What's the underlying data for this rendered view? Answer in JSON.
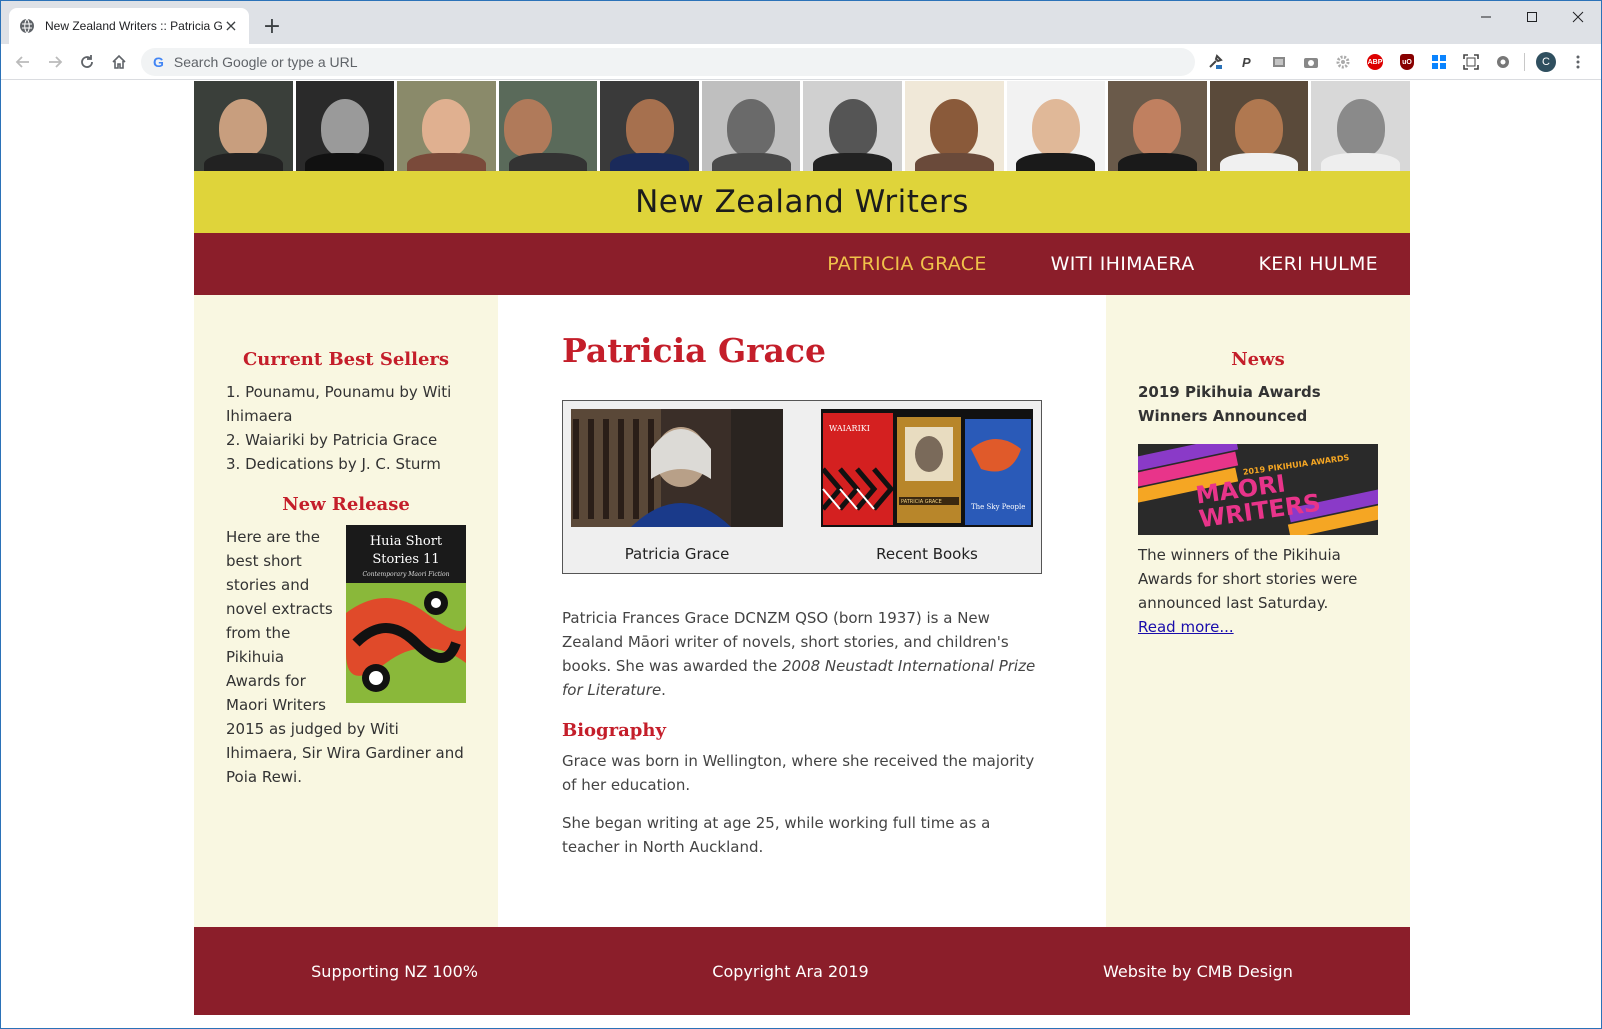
{
  "browser": {
    "tab_title": "New Zealand Writers :: Patricia Gr",
    "tab_close": "×",
    "new_tab": "+",
    "omnibox_placeholder": "Search Google or type a URL",
    "omnibox_logo": "G",
    "profile_initial": "C",
    "ext_abp": "ABP",
    "ext_ubo": "uO"
  },
  "site": {
    "title": "New Zealand Writers",
    "nav": [
      {
        "label": "PATRICIA GRACE",
        "active": true
      },
      {
        "label": "WITI IHIMAERA",
        "active": false
      },
      {
        "label": "KERI HULME",
        "active": false
      }
    ],
    "left": {
      "bestsellers_heading": "Current Best Sellers",
      "bestsellers": [
        "1. Pounamu, Pounamu by Witi Ihimaera",
        "2. Waiariki by Patricia Grace",
        "3. Dedications by J. C. Sturm"
      ],
      "release_heading": "New Release",
      "release_text": "Here are the best short stories and novel extracts from the Pikihuia Awards for Maori Writers 2015 as judged by Witi Ihimaera, Sir Wira Gardiner and Poia Rewi.",
      "release_cover_title": "Huia Short Stories 11",
      "release_cover_sub": "Contemporary Maori Fiction"
    },
    "main": {
      "title": "Patricia Grace",
      "figure1_caption": "Patricia Grace",
      "figure2_caption": "Recent Books",
      "book1_title": "WAIARIKI",
      "book2_title": "PATRICIA GRACE",
      "book3_title": "The Sky People",
      "intro_before": "Patricia Frances Grace DCNZM QSO (born 1937) is a New Zealand Māori writer of novels, short stories, and children's books. She was awarded the ",
      "intro_em": "2008 Neustadt International Prize for Literature",
      "intro_after": ".",
      "bio_heading": "Biography",
      "bio_p1": "Grace was born in Wellington, where she received the majority of her education.",
      "bio_p2": "She began writing at age 25, while working full time as a teacher in North Auckland."
    },
    "right": {
      "news_heading": "News",
      "news_headline": "2019 Pikihuia Awards Winners Announced",
      "news_img_small": "2019 PIKIHUIA AWARDS",
      "news_img_text": "MAORI WRITERS",
      "news_text": "The winners of the Pikihuia Awards for short stories were announced last Saturday.",
      "news_link": "Read more..."
    },
    "footer": {
      "left": "Supporting NZ 100%",
      "center": "Copyright Ara 2019",
      "right": "Website by CMB Design"
    }
  },
  "colors": {
    "banner": "#dfd43a",
    "nav_bg": "#8b1e2a",
    "nav_active": "#f0c24a",
    "heading_red": "#c41e2a",
    "sidebar_bg": "#f9f7e1"
  }
}
